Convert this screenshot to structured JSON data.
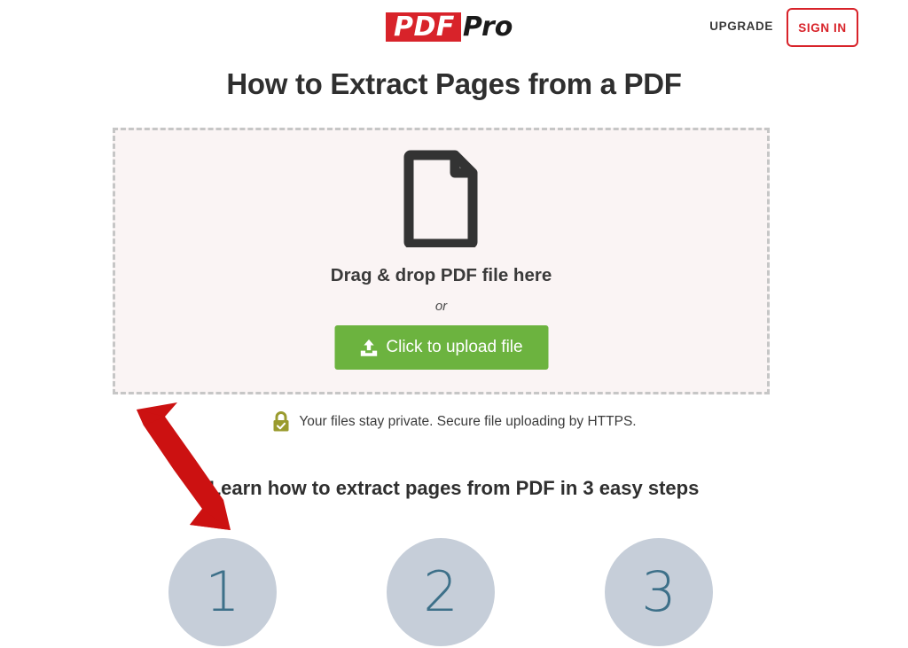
{
  "header": {
    "logo_mark": "PDF",
    "logo_word": "Pro",
    "upgrade_label": "UPGRADE",
    "signin_label": "SIGN IN",
    "brand_red": "#d8232a"
  },
  "page_title": "How to Extract Pages from a PDF",
  "dropzone": {
    "icon": "document-icon",
    "drop_title": "Drag & drop PDF file here",
    "or_label": "or",
    "upload_button_label": "Click to upload file",
    "upload_button_color": "#6cb33f",
    "border_style": "dashed",
    "background": "#faf4f4"
  },
  "privacy": {
    "icon": "lock-check-icon",
    "icon_color": "#9a9b2e",
    "text": "Your files stay private. Secure file uploading by HTTPS."
  },
  "steps": {
    "heading": "Learn how to extract pages from PDF in 3 easy steps",
    "circle_color": "#c6ced9",
    "number_color": "#3d7089",
    "items": [
      {
        "number": "1"
      },
      {
        "number": "2"
      },
      {
        "number": "3"
      }
    ]
  },
  "annotation": {
    "name": "double-headed-arrow",
    "color": "#cc1111",
    "direction": "diagonal-up-left-and-down-right"
  }
}
